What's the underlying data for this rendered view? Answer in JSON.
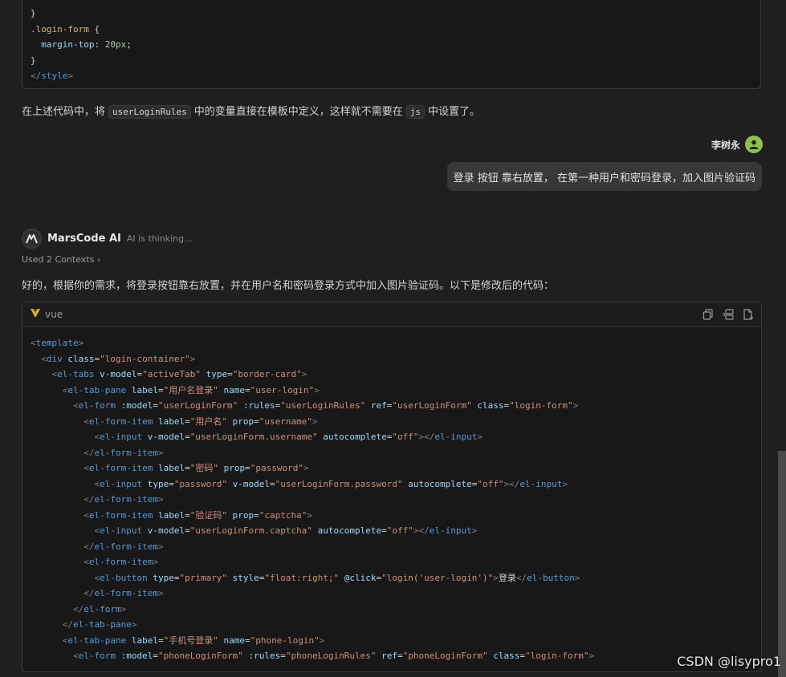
{
  "top_code": {
    "lines": [
      [
        {
          "t": "}",
          "c": "plain"
        }
      ],
      [
        {
          "t": ".login-form",
          "c": "cls"
        },
        {
          "t": " {",
          "c": "plain"
        }
      ],
      [
        {
          "t": "  margin-top",
          "c": "attr"
        },
        {
          "t": ": ",
          "c": "plain"
        },
        {
          "t": "20px",
          "c": "num"
        },
        {
          "t": ";",
          "c": "plain"
        }
      ],
      [
        {
          "t": "}",
          "c": "plain"
        }
      ],
      [
        {
          "t": "</",
          "c": "gray"
        },
        {
          "t": "style",
          "c": "tag"
        },
        {
          "t": ">",
          "c": "gray"
        }
      ]
    ]
  },
  "explanation": {
    "before": "在上述代码中，将",
    "code1": "userLoginRules",
    "middle": "中的变量直接在模板中定义，这样就不需要在",
    "code2": "js",
    "after": "中设置了。"
  },
  "user": {
    "name": "李树永",
    "message": "登录 按钮 靠右放置， 在第一种用户和密码登录，加入图片验证码"
  },
  "ai": {
    "name": "MarsCode AI",
    "status": "AI is thinking...",
    "contexts": "Used 2 Contexts",
    "intro": "好的，根据你的需求，将登录按钮靠右放置，并在用户名和密码登录方式中加入图片验证码。以下是修改后的代码："
  },
  "code_block": {
    "language": "vue",
    "lines": [
      [
        {
          "t": "<",
          "c": "gray"
        },
        {
          "t": "template",
          "c": "tag"
        },
        {
          "t": ">",
          "c": "gray"
        }
      ],
      [
        {
          "t": "  <",
          "c": "gray"
        },
        {
          "t": "div",
          "c": "tag"
        },
        {
          "t": " class",
          "c": "attr"
        },
        {
          "t": "=",
          "c": "plain"
        },
        {
          "t": "\"login-container\"",
          "c": "str"
        },
        {
          "t": ">",
          "c": "gray"
        }
      ],
      [
        {
          "t": "    <",
          "c": "gray"
        },
        {
          "t": "el-tabs",
          "c": "tag"
        },
        {
          "t": " v-model",
          "c": "attr"
        },
        {
          "t": "=",
          "c": "plain"
        },
        {
          "t": "\"activeTab\"",
          "c": "str"
        },
        {
          "t": " type",
          "c": "attr"
        },
        {
          "t": "=",
          "c": "plain"
        },
        {
          "t": "\"border-card\"",
          "c": "str"
        },
        {
          "t": ">",
          "c": "gray"
        }
      ],
      [
        {
          "t": "      <",
          "c": "gray"
        },
        {
          "t": "el-tab-pane",
          "c": "tag"
        },
        {
          "t": " label",
          "c": "attr"
        },
        {
          "t": "=",
          "c": "plain"
        },
        {
          "t": "\"用户名登录\"",
          "c": "str"
        },
        {
          "t": " name",
          "c": "attr"
        },
        {
          "t": "=",
          "c": "plain"
        },
        {
          "t": "\"user-login\"",
          "c": "str"
        },
        {
          "t": ">",
          "c": "gray"
        }
      ],
      [
        {
          "t": "        <",
          "c": "gray"
        },
        {
          "t": "el-form",
          "c": "tag"
        },
        {
          "t": " :model",
          "c": "attr"
        },
        {
          "t": "=",
          "c": "plain"
        },
        {
          "t": "\"userLoginForm\"",
          "c": "str"
        },
        {
          "t": " :rules",
          "c": "attr"
        },
        {
          "t": "=",
          "c": "plain"
        },
        {
          "t": "\"userLoginRules\"",
          "c": "str"
        },
        {
          "t": " ref",
          "c": "attr"
        },
        {
          "t": "=",
          "c": "plain"
        },
        {
          "t": "\"userLoginForm\"",
          "c": "str"
        },
        {
          "t": " class",
          "c": "attr"
        },
        {
          "t": "=",
          "c": "plain"
        },
        {
          "t": "\"login-form\"",
          "c": "str"
        },
        {
          "t": ">",
          "c": "gray"
        }
      ],
      [
        {
          "t": "          <",
          "c": "gray"
        },
        {
          "t": "el-form-item",
          "c": "tag"
        },
        {
          "t": " label",
          "c": "attr"
        },
        {
          "t": "=",
          "c": "plain"
        },
        {
          "t": "\"用户名\"",
          "c": "str"
        },
        {
          "t": " prop",
          "c": "attr"
        },
        {
          "t": "=",
          "c": "plain"
        },
        {
          "t": "\"username\"",
          "c": "str"
        },
        {
          "t": ">",
          "c": "gray"
        }
      ],
      [
        {
          "t": "            <",
          "c": "gray"
        },
        {
          "t": "el-input",
          "c": "tag"
        },
        {
          "t": " v-model",
          "c": "attr"
        },
        {
          "t": "=",
          "c": "plain"
        },
        {
          "t": "\"userLoginForm.username\"",
          "c": "str"
        },
        {
          "t": " autocomplete",
          "c": "attr"
        },
        {
          "t": "=",
          "c": "plain"
        },
        {
          "t": "\"off\"",
          "c": "str"
        },
        {
          "t": "></",
          "c": "gray"
        },
        {
          "t": "el-input",
          "c": "tag"
        },
        {
          "t": ">",
          "c": "gray"
        }
      ],
      [
        {
          "t": "          </",
          "c": "gray"
        },
        {
          "t": "el-form-item",
          "c": "tag"
        },
        {
          "t": ">",
          "c": "gray"
        }
      ],
      [
        {
          "t": "          <",
          "c": "gray"
        },
        {
          "t": "el-form-item",
          "c": "tag"
        },
        {
          "t": " label",
          "c": "attr"
        },
        {
          "t": "=",
          "c": "plain"
        },
        {
          "t": "\"密码\"",
          "c": "str"
        },
        {
          "t": " prop",
          "c": "attr"
        },
        {
          "t": "=",
          "c": "plain"
        },
        {
          "t": "\"password\"",
          "c": "str"
        },
        {
          "t": ">",
          "c": "gray"
        }
      ],
      [
        {
          "t": "            <",
          "c": "gray"
        },
        {
          "t": "el-input",
          "c": "tag"
        },
        {
          "t": " type",
          "c": "attr"
        },
        {
          "t": "=",
          "c": "plain"
        },
        {
          "t": "\"password\"",
          "c": "str"
        },
        {
          "t": " v-model",
          "c": "attr"
        },
        {
          "t": "=",
          "c": "plain"
        },
        {
          "t": "\"userLoginForm.password\"",
          "c": "str"
        },
        {
          "t": " autocomplete",
          "c": "attr"
        },
        {
          "t": "=",
          "c": "plain"
        },
        {
          "t": "\"off\"",
          "c": "str"
        },
        {
          "t": "></",
          "c": "gray"
        },
        {
          "t": "el-input",
          "c": "tag"
        },
        {
          "t": ">",
          "c": "gray"
        }
      ],
      [
        {
          "t": "          </",
          "c": "gray"
        },
        {
          "t": "el-form-item",
          "c": "tag"
        },
        {
          "t": ">",
          "c": "gray"
        }
      ],
      [
        {
          "t": "          <",
          "c": "gray"
        },
        {
          "t": "el-form-item",
          "c": "tag"
        },
        {
          "t": " label",
          "c": "attr"
        },
        {
          "t": "=",
          "c": "plain"
        },
        {
          "t": "\"验证码\"",
          "c": "str"
        },
        {
          "t": " prop",
          "c": "attr"
        },
        {
          "t": "=",
          "c": "plain"
        },
        {
          "t": "\"captcha\"",
          "c": "str"
        },
        {
          "t": ">",
          "c": "gray"
        }
      ],
      [
        {
          "t": "            <",
          "c": "gray"
        },
        {
          "t": "el-input",
          "c": "tag"
        },
        {
          "t": " v-model",
          "c": "attr"
        },
        {
          "t": "=",
          "c": "plain"
        },
        {
          "t": "\"userLoginForm.captcha\"",
          "c": "str"
        },
        {
          "t": " autocomplete",
          "c": "attr"
        },
        {
          "t": "=",
          "c": "plain"
        },
        {
          "t": "\"off\"",
          "c": "str"
        },
        {
          "t": "></",
          "c": "gray"
        },
        {
          "t": "el-input",
          "c": "tag"
        },
        {
          "t": ">",
          "c": "gray"
        }
      ],
      [
        {
          "t": "          </",
          "c": "gray"
        },
        {
          "t": "el-form-item",
          "c": "tag"
        },
        {
          "t": ">",
          "c": "gray"
        }
      ],
      [
        {
          "t": "          <",
          "c": "gray"
        },
        {
          "t": "el-form-item",
          "c": "tag"
        },
        {
          "t": ">",
          "c": "gray"
        }
      ],
      [
        {
          "t": "            <",
          "c": "gray"
        },
        {
          "t": "el-button",
          "c": "tag"
        },
        {
          "t": " type",
          "c": "attr"
        },
        {
          "t": "=",
          "c": "plain"
        },
        {
          "t": "\"primary\"",
          "c": "str"
        },
        {
          "t": " style",
          "c": "attr"
        },
        {
          "t": "=",
          "c": "plain"
        },
        {
          "t": "\"float:right;\"",
          "c": "str"
        },
        {
          "t": " @click",
          "c": "attr"
        },
        {
          "t": "=",
          "c": "plain"
        },
        {
          "t": "\"login('user-login')\"",
          "c": "str"
        },
        {
          "t": ">",
          "c": "gray"
        },
        {
          "t": "登录",
          "c": "plain"
        },
        {
          "t": "</",
          "c": "gray"
        },
        {
          "t": "el-button",
          "c": "tag"
        },
        {
          "t": ">",
          "c": "gray"
        }
      ],
      [
        {
          "t": "          </",
          "c": "gray"
        },
        {
          "t": "el-form-item",
          "c": "tag"
        },
        {
          "t": ">",
          "c": "gray"
        }
      ],
      [
        {
          "t": "        </",
          "c": "gray"
        },
        {
          "t": "el-form",
          "c": "tag"
        },
        {
          "t": ">",
          "c": "gray"
        }
      ],
      [
        {
          "t": "      </",
          "c": "gray"
        },
        {
          "t": "el-tab-pane",
          "c": "tag"
        },
        {
          "t": ">",
          "c": "gray"
        }
      ],
      [
        {
          "t": "      <",
          "c": "gray"
        },
        {
          "t": "el-tab-pane",
          "c": "tag"
        },
        {
          "t": " label",
          "c": "attr"
        },
        {
          "t": "=",
          "c": "plain"
        },
        {
          "t": "\"手机号登录\"",
          "c": "str"
        },
        {
          "t": " name",
          "c": "attr"
        },
        {
          "t": "=",
          "c": "plain"
        },
        {
          "t": "\"phone-login\"",
          "c": "str"
        },
        {
          "t": ">",
          "c": "gray"
        }
      ],
      [
        {
          "t": "        <",
          "c": "gray"
        },
        {
          "t": "el-form",
          "c": "tag"
        },
        {
          "t": " :model",
          "c": "attr"
        },
        {
          "t": "=",
          "c": "plain"
        },
        {
          "t": "\"phoneLoginForm\"",
          "c": "str"
        },
        {
          "t": " :rules",
          "c": "attr"
        },
        {
          "t": "=",
          "c": "plain"
        },
        {
          "t": "\"phoneLoginRules\"",
          "c": "str"
        },
        {
          "t": " ref",
          "c": "attr"
        },
        {
          "t": "=",
          "c": "plain"
        },
        {
          "t": "\"phoneLoginForm\"",
          "c": "str"
        },
        {
          "t": " class",
          "c": "attr"
        },
        {
          "t": "=",
          "c": "plain"
        },
        {
          "t": "\"login-form\"",
          "c": "str"
        },
        {
          "t": ">",
          "c": "gray"
        }
      ]
    ]
  },
  "watermark": "CSDN @lisypro1",
  "icons": {
    "copy": "copy-icon",
    "insert": "insert-icon",
    "new_file": "new-file-icon",
    "vue": "vue-icon",
    "user": "user-avatar-icon",
    "logo": "marscode-logo-icon"
  }
}
